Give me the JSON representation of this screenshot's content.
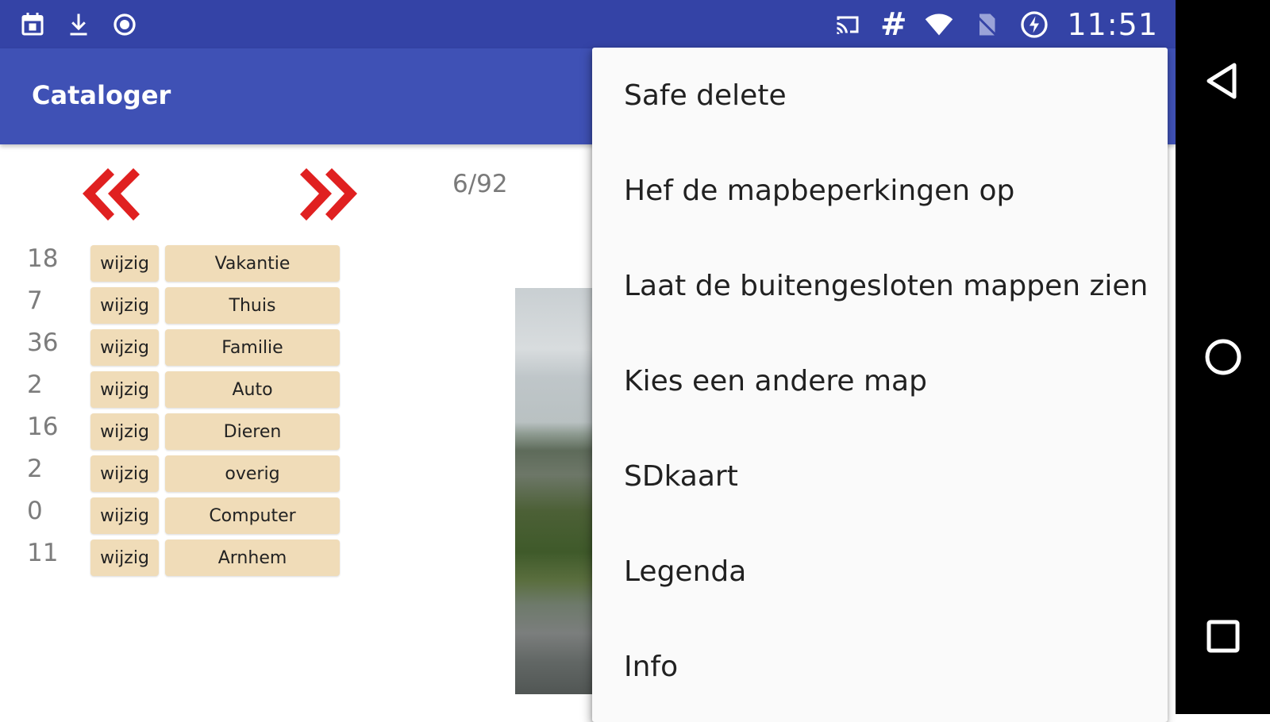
{
  "status_bar": {
    "time": "11:51",
    "hash_symbol": "#",
    "left_icons": [
      "calendar-icon",
      "download-icon",
      "record-icon"
    ],
    "right_icons": [
      "cast-icon",
      "wifi-icon",
      "no-sim-icon",
      "battery-charging-icon"
    ]
  },
  "app_bar": {
    "title": "Cataloger",
    "color": "#3f51b5",
    "status_color": "#3443a6"
  },
  "navigation": {
    "prev_icon": "double-chevron-left-icon",
    "next_icon": "double-chevron-right-icon",
    "arrow_color": "#e02020",
    "counter": "6/92"
  },
  "categories": [
    {
      "count": "18",
      "edit_label": "wijzig",
      "name": "Vakantie"
    },
    {
      "count": "7",
      "edit_label": "wijzig",
      "name": "Thuis"
    },
    {
      "count": "36",
      "edit_label": "wijzig",
      "name": "Familie"
    },
    {
      "count": "2",
      "edit_label": "wijzig",
      "name": "Auto"
    },
    {
      "count": "16",
      "edit_label": "wijzig",
      "name": "Dieren"
    },
    {
      "count": "2",
      "edit_label": "wijzig",
      "name": "overig"
    },
    {
      "count": "0",
      "edit_label": "wijzig",
      "name": "Computer"
    },
    {
      "count": "11",
      "edit_label": "wijzig",
      "name": "Arnhem"
    }
  ],
  "menu": {
    "items": [
      "Safe delete",
      "Hef de mapbeperkingen op",
      "Laat de buitengesloten mappen zien",
      "Kies een andere map",
      "SDkaart",
      "Legenda",
      "Info"
    ]
  },
  "system_nav": {
    "icons": [
      "back-icon",
      "home-icon",
      "recents-icon"
    ]
  }
}
